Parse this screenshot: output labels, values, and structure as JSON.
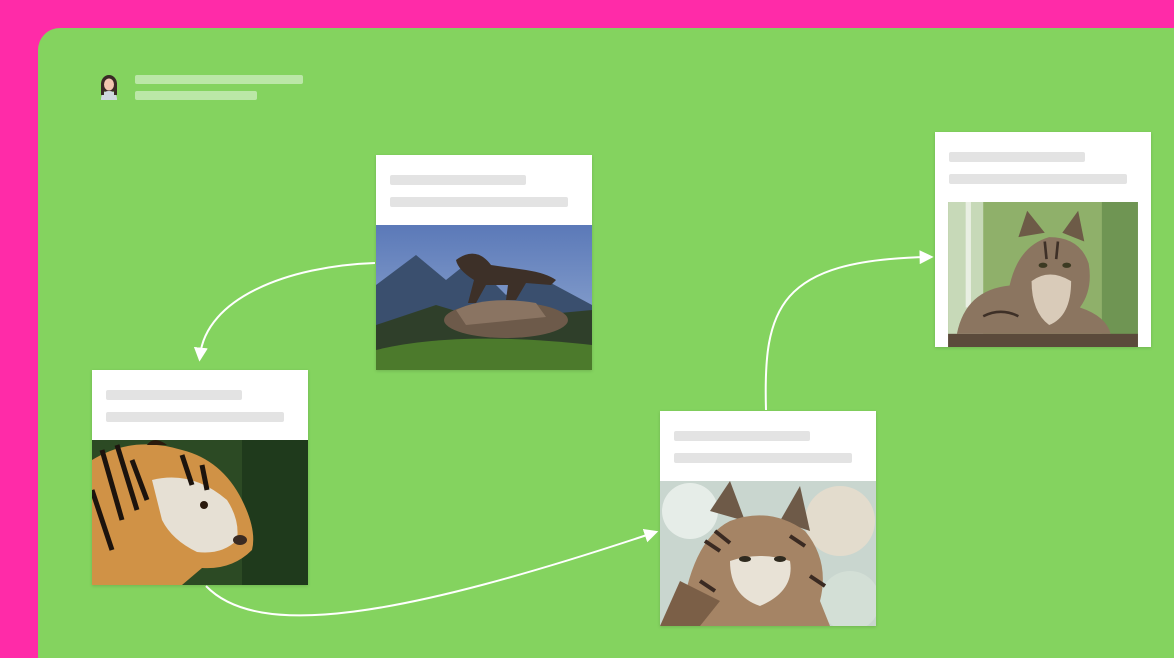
{
  "colors": {
    "frame": "#ff2ba8",
    "canvas": "#84d35f",
    "connector": "#ffffff",
    "card": "#ffffff",
    "placeholder": "#e3e3e3"
  },
  "board": {
    "owner": {
      "avatar_icon": "user-avatar-icon"
    },
    "cards": [
      {
        "id": "tiger",
        "image": "tiger-photo"
      },
      {
        "id": "leopard",
        "image": "leopard-on-rock-photo"
      },
      {
        "id": "lynx",
        "image": "lynx-photo"
      },
      {
        "id": "maine-coon",
        "image": "maine-coon-cat-photo"
      }
    ],
    "connections": [
      {
        "from": "leopard",
        "to": "tiger"
      },
      {
        "from": "tiger",
        "to": "lynx"
      },
      {
        "from": "lynx",
        "to": "maine-coon"
      }
    ]
  }
}
